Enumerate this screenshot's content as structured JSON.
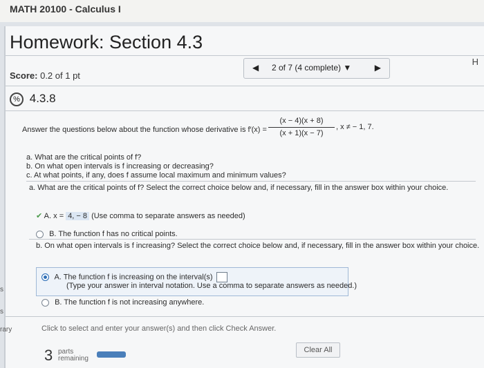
{
  "course_title": "MATH 20100 - Calculus I",
  "homework_title": "Homework: Section 4.3",
  "header_right": "H",
  "score_label": "Score:",
  "score_value": "0.2 of 1 pt",
  "nav": {
    "position": "2 of 7 (4 complete)",
    "prev": "◀",
    "next": "▶",
    "dropdown": "▼"
  },
  "question": {
    "number": "4.3.8",
    "prompt_start": "Answer the questions below about the function whose derivative is f′(x) =",
    "numerator": "(x − 4)(x + 8)",
    "denominator": "(x + 1)(x − 7)",
    "condition": ", x ≠ − 1, 7.",
    "parts": [
      "a. What are the critical points of f?",
      "b. On what open intervals is f increasing or decreasing?",
      "c. At what points, if any, does f assume local maximum and minimum values?"
    ],
    "part_a_prompt": "a. What are the critical points of f? Select the correct choice below and, if necessary, fill in the answer box within your choice.",
    "part_a_choice_a_prefix": "A.",
    "part_a_choice_a_x": "x =",
    "part_a_choice_a_value": "4, − 8",
    "part_a_choice_a_hint": "(Use comma to separate answers as needed)",
    "part_a_choice_b": "B.   The function f has no critical points.",
    "part_b_prompt": "b. On what open intervals is f increasing? Select the correct choice below and, if necessary, fill in the answer box within your choice.",
    "part_b_choice_a": "A.   The function f is increasing on the interval(s)",
    "part_b_choice_a_hint": "(Type your answer in interval notation. Use a comma to separate answers as needed.)",
    "part_b_choice_b": "B.   The function f is not increasing anywhere."
  },
  "instruction": "Click to select and enter your answer(s) and then click Check Answer.",
  "parts_remaining_count": "3",
  "parts_remaining_label_1": "parts",
  "parts_remaining_label_2": "remaining",
  "clear_all": "Clear All",
  "side_labels": {
    "s1": "s",
    "s2": "s",
    "rary": "rary"
  }
}
